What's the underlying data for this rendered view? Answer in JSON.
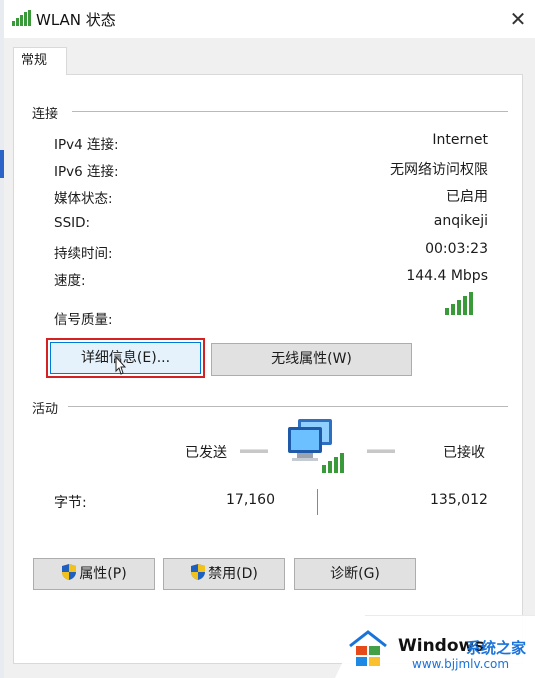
{
  "window": {
    "title": "WLAN 状态",
    "close_glyph": "✕"
  },
  "tabs": [
    {
      "label": "常规"
    }
  ],
  "connection": {
    "group_label": "连接",
    "rows": [
      {
        "label": "IPv4 连接:",
        "value": "Internet"
      },
      {
        "label": "IPv6 连接:",
        "value": "无网络访问权限"
      },
      {
        "label": "媒体状态:",
        "value": "已启用"
      },
      {
        "label": "SSID:",
        "value": "anqikeji"
      },
      {
        "label": "持续时间:",
        "value": "00:03:23"
      },
      {
        "label": "速度:",
        "value": "144.4 Mbps"
      }
    ],
    "signal_label": "信号质量:",
    "signal_bars": 5,
    "details_button": "详细信息(E)...",
    "wireless_button": "无线属性(W)"
  },
  "activity": {
    "group_label": "活动",
    "sent_label": "已发送",
    "received_label": "已接收",
    "bytes_label": "字节:",
    "bytes_sent": "17,160",
    "bytes_received": "135,012"
  },
  "buttons": {
    "properties": "属性(P)",
    "disable": "禁用(D)",
    "diagnose": "诊断(G)"
  },
  "watermark": {
    "brand": "Windows",
    "cn": "系统之家",
    "url": "www.bjjmlv.com"
  },
  "colors": {
    "signal_green": "#3a9a3a",
    "highlight_red": "#d42121",
    "focus_blue": "#0078d7",
    "shield_blue": "#1e5fbf",
    "shield_yellow": "#f2c21b"
  }
}
